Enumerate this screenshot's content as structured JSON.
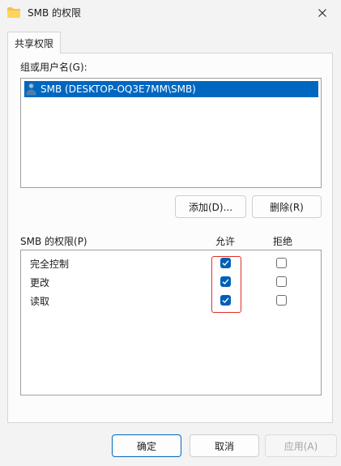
{
  "window": {
    "title": "SMB 的权限",
    "folder_icon": "folder-icon",
    "close_icon": "close-icon"
  },
  "tabs": [
    {
      "label": "共享权限",
      "selected": true
    }
  ],
  "groups": {
    "label": "组或用户名(G):",
    "items": [
      {
        "icon": "user-icon",
        "name": "SMB (DESKTOP-OQ3E7MM\\SMB)",
        "selected": true
      }
    ],
    "add_label": "添加(D)...",
    "remove_label": "删除(R)"
  },
  "permissions": {
    "title": "SMB 的权限(P)",
    "allow_header": "允许",
    "deny_header": "拒绝",
    "rows": [
      {
        "name": "完全控制",
        "allow": true,
        "deny": false
      },
      {
        "name": "更改",
        "allow": true,
        "deny": false
      },
      {
        "name": "读取",
        "allow": true,
        "deny": false
      }
    ]
  },
  "footer": {
    "ok_label": "确定",
    "cancel_label": "取消",
    "apply_label": "应用(A)",
    "apply_enabled": false
  },
  "colors": {
    "accent": "#005fb8",
    "selection": "#0067c0",
    "highlight_box": "#e0302a"
  }
}
